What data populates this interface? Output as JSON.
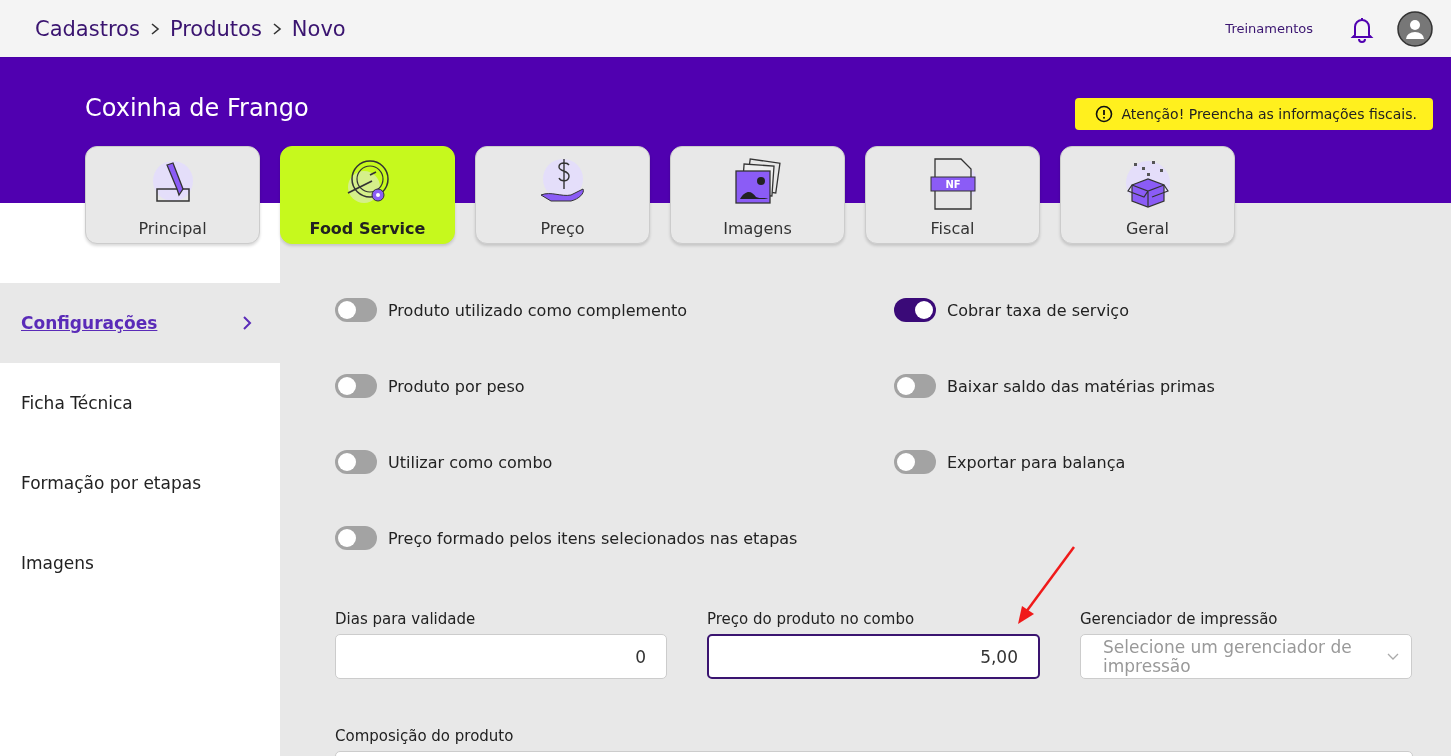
{
  "breadcrumb": [
    "Cadastros",
    "Produtos",
    "Novo"
  ],
  "top_link": "Treinamentos",
  "product_title": "Coxinha de Frango",
  "alert": "Atenção! Preencha as informações fiscais.",
  "tabs": [
    {
      "label": "Principal",
      "kind": "pencil",
      "selected": false
    },
    {
      "label": "Food Service",
      "kind": "plate",
      "selected": true
    },
    {
      "label": "Preço",
      "kind": "money",
      "selected": false
    },
    {
      "label": "Imagens",
      "kind": "images",
      "selected": false
    },
    {
      "label": "Fiscal",
      "kind": "document",
      "icon_text": "NF",
      "selected": false
    },
    {
      "label": "Geral",
      "kind": "box",
      "selected": false
    }
  ],
  "sidebar": {
    "items": [
      {
        "label": "Configurações",
        "selected": true
      },
      {
        "label": "Ficha Técnica",
        "selected": false
      },
      {
        "label": "Formação por etapas",
        "selected": false
      },
      {
        "label": "Imagens",
        "selected": false
      }
    ]
  },
  "toggles": [
    {
      "label": "Produto utilizado como complemento",
      "on": false
    },
    {
      "label": "Cobrar taxa de serviço",
      "on": true
    },
    {
      "label": "Produto por peso",
      "on": false
    },
    {
      "label": "Baixar saldo das matérias primas",
      "on": false
    },
    {
      "label": "Utilizar como combo",
      "on": false
    },
    {
      "label": "Exportar para balança",
      "on": false
    },
    {
      "label": "Preço formado pelos itens selecionados nas etapas",
      "on": false
    }
  ],
  "fields": [
    {
      "label": "Dias para validade",
      "kind": "input",
      "value": "0",
      "focused": false
    },
    {
      "label": "Preço do produto no combo",
      "kind": "input",
      "value": "5,00",
      "focused": true
    },
    {
      "label": "Gerenciador de impressão",
      "kind": "select",
      "placeholder": "Selecione um gerenciador de impressão",
      "focused": false
    }
  ],
  "composition": {
    "label": "Composição do produto"
  }
}
